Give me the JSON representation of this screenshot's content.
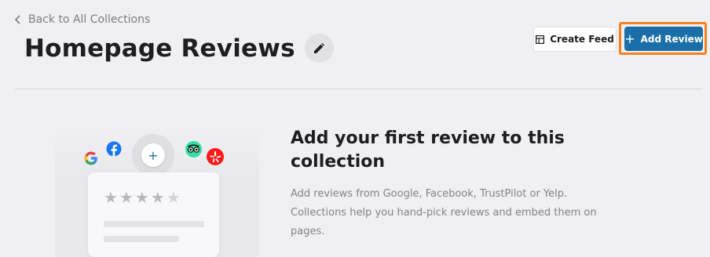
{
  "nav": {
    "back_label": "Back to All Collections"
  },
  "header": {
    "title": "Homepage Reviews",
    "create_feed_label": "Create Feed",
    "add_review_label": "Add Review"
  },
  "empty_state": {
    "heading": "Add your first review to this collection",
    "description": "Add reviews from Google, Facebook, TrustPilot or Yelp. Collections help you hand-pick reviews and embed them on pages.",
    "add_symbol": "+",
    "rating_illustration": 4,
    "rating_max": 5
  },
  "colors": {
    "primary": "#1b6fa8",
    "highlight_outline": "#f5821f",
    "background": "#f0f0f3"
  },
  "icons": [
    "chevron-left-icon",
    "pencil-icon",
    "layout-icon",
    "plus-icon",
    "google-icon",
    "facebook-icon",
    "tripadvisor-icon",
    "yelp-icon",
    "star-icon"
  ]
}
